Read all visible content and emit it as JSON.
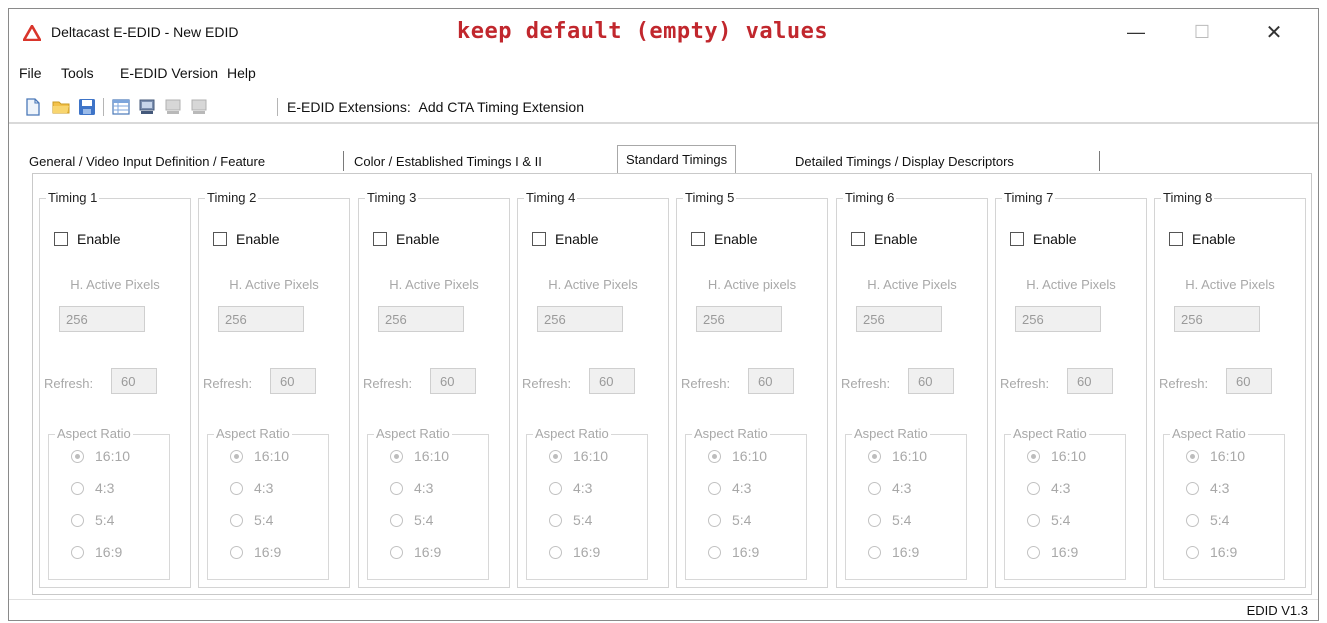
{
  "window": {
    "title": "Deltacast E-EDID - New EDID",
    "minimize_glyph": "—",
    "maximize_glyph": "☐",
    "close_glyph": "✕"
  },
  "annotation": "keep default (empty) values",
  "menu": [
    "File",
    "Tools",
    "E-EDID Version",
    "Help"
  ],
  "toolbar": {
    "buttons": [
      "new-file-icon",
      "open-folder-icon",
      "save-icon",
      "table-view-icon",
      "save-to-device-icon",
      "read-device-icon",
      "write-device-icon"
    ],
    "extensions_label": "E-EDID Extensions:",
    "add_extension_label": "Add CTA Timing Extension"
  },
  "tabs": [
    "General / Video Input Definition / Feature",
    "Color / Established Timings I & II",
    "Standard Timings",
    "Detailed Timings / Display Descriptors"
  ],
  "active_tab": "Standard Timings",
  "timings": [
    {
      "title": "Timing 1",
      "enable_label": "Enable",
      "enabled": false,
      "hap_label": "H. Active Pixels",
      "hap_value": "256",
      "refresh_label": "Refresh:",
      "refresh_value": "60",
      "aspect_label": "Aspect Ratio",
      "ratios": [
        "16:10",
        "4:3",
        "5:4",
        "16:9"
      ],
      "selected_ratio": "16:10"
    },
    {
      "title": "Timing 2",
      "enable_label": "Enable",
      "enabled": false,
      "hap_label": "H. Active Pixels",
      "hap_value": "256",
      "refresh_label": "Refresh:",
      "refresh_value": "60",
      "aspect_label": "Aspect Ratio",
      "ratios": [
        "16:10",
        "4:3",
        "5:4",
        "16:9"
      ],
      "selected_ratio": "16:10"
    },
    {
      "title": "Timing 3",
      "enable_label": "Enable",
      "enabled": false,
      "hap_label": "H. Active Pixels",
      "hap_value": "256",
      "refresh_label": "Refresh:",
      "refresh_value": "60",
      "aspect_label": "Aspect Ratio",
      "ratios": [
        "16:10",
        "4:3",
        "5:4",
        "16:9"
      ],
      "selected_ratio": "16:10"
    },
    {
      "title": "Timing 4",
      "enable_label": "Enable",
      "enabled": false,
      "hap_label": "H. Active Pixels",
      "hap_value": "256",
      "refresh_label": "Refresh:",
      "refresh_value": "60",
      "aspect_label": "Aspect Ratio",
      "ratios": [
        "16:10",
        "4:3",
        "5:4",
        "16:9"
      ],
      "selected_ratio": "16:10"
    },
    {
      "title": "Timing 5",
      "enable_label": "Enable",
      "enabled": false,
      "hap_label": "H. Active pixels",
      "hap_value": "256",
      "refresh_label": "Refresh:",
      "refresh_value": "60",
      "aspect_label": "Aspect Ratio",
      "ratios": [
        "16:10",
        "4:3",
        "5:4",
        "16:9"
      ],
      "selected_ratio": "16:10"
    },
    {
      "title": "Timing 6",
      "enable_label": "Enable",
      "enabled": false,
      "hap_label": "H. Active Pixels",
      "hap_value": "256",
      "refresh_label": "Refresh:",
      "refresh_value": "60",
      "aspect_label": "Aspect Ratio",
      "ratios": [
        "16:10",
        "4:3",
        "5:4",
        "16:9"
      ],
      "selected_ratio": "16:10"
    },
    {
      "title": "Timing 7",
      "enable_label": "Enable",
      "enabled": false,
      "hap_label": "H. Active Pixels",
      "hap_value": "256",
      "refresh_label": "Refresh:",
      "refresh_value": "60",
      "aspect_label": "Aspect Ratio",
      "ratios": [
        "16:10",
        "4:3",
        "5:4",
        "16:9"
      ],
      "selected_ratio": "16:10"
    },
    {
      "title": "Timing 8",
      "enable_label": "Enable",
      "enabled": false,
      "hap_label": "H. Active Pixels",
      "hap_value": "256",
      "refresh_label": "Refresh:",
      "refresh_value": "60",
      "aspect_label": "Aspect Ratio",
      "ratios": [
        "16:10",
        "4:3",
        "5:4",
        "16:9"
      ],
      "selected_ratio": "16:10"
    }
  ],
  "status": "EDID V1.3",
  "colors": {
    "annotation_red": "#c1272d",
    "app_icon_red": "#d9352b",
    "disabled_text": "#a8a8a8"
  }
}
